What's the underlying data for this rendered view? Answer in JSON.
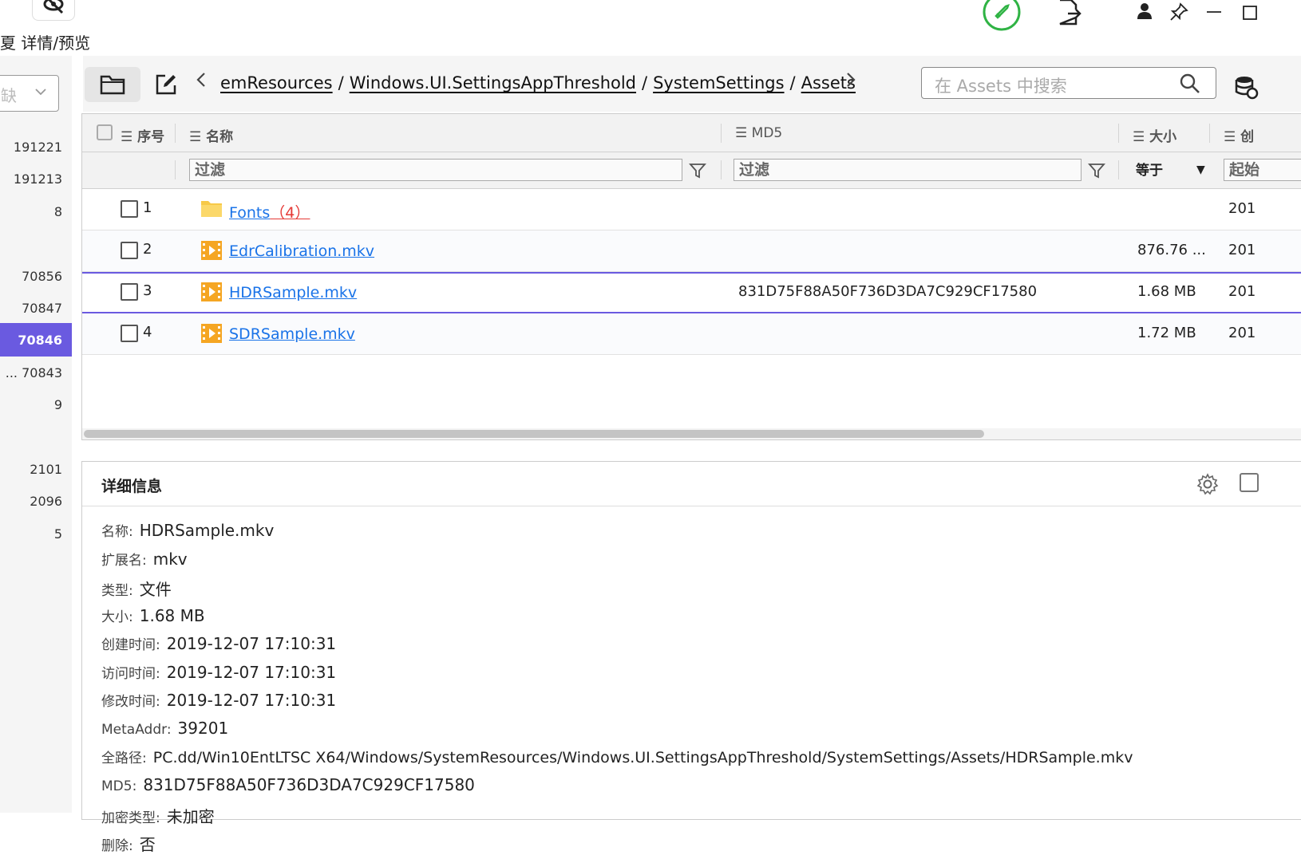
{
  "header": {
    "detail_label": "夏 详情/预览"
  },
  "left_pane": {
    "combo_text": "缺",
    "numbers": [
      "191221",
      "191213",
      "8",
      "70856",
      "70847",
      "70846",
      "... 70843",
      "9",
      "2101",
      "2096",
      "5"
    ],
    "selected_index": 5
  },
  "toolbar": {
    "breadcrumb": [
      "emResources",
      "Windows.UI.SettingsAppThreshold",
      "SystemSettings",
      "Assets"
    ],
    "breadcrumb_sep": "/",
    "search_placeholder": "在 Assets 中搜索"
  },
  "grid": {
    "columns": [
      "序号",
      "名称",
      "MD5",
      "大小",
      "创"
    ],
    "filter_placeholder": "过滤",
    "size_filter": "等于",
    "date_filter": "起始",
    "rows": [
      {
        "num": "1",
        "name": "Fonts",
        "count": "（4）",
        "type": "folder",
        "md5": "",
        "size": "",
        "date": "201"
      },
      {
        "num": "2",
        "name": "EdrCalibration.mkv",
        "count": "",
        "type": "video",
        "md5": "",
        "size": "876.76 ...",
        "date": "201"
      },
      {
        "num": "3",
        "name": "HDRSample.mkv",
        "count": "",
        "type": "video",
        "md5": "831D75F88A50F736D3DA7C929CF17580",
        "size": "1.68 MB",
        "date": "201"
      },
      {
        "num": "4",
        "name": "SDRSample.mkv",
        "count": "",
        "type": "video",
        "md5": "",
        "size": "1.72 MB",
        "date": "201"
      }
    ],
    "selected_row": 2
  },
  "details": {
    "title": "详细信息",
    "props": [
      {
        "k": "名称:",
        "v": "HDRSample.mkv"
      },
      {
        "k": "扩展名:",
        "v": "mkv"
      },
      {
        "k": "类型:",
        "v": "文件"
      },
      {
        "k": "大小:",
        "v": "1.68 MB"
      },
      {
        "k": "创建时间:",
        "v": "2019-12-07 17:10:31"
      },
      {
        "k": "访问时间:",
        "v": "2019-12-07 17:10:31"
      },
      {
        "k": "修改时间:",
        "v": "2019-12-07 17:10:31"
      },
      {
        "k": "MetaAddr:",
        "v": "39201"
      },
      {
        "k": "全路径:",
        "v": "PC.dd/Win10EntLTSC X64/Windows/SystemResources/Windows.UI.SettingsAppThreshold/SystemSettings/Assets/HDRSample.mkv"
      },
      {
        "k": "MD5:",
        "v": "831D75F88A50F736D3DA7C929CF17580"
      },
      {
        "k": "加密类型:",
        "v": "未加密"
      },
      {
        "k": "删除:",
        "v": "否"
      }
    ]
  },
  "colors": {
    "accent": "#6a5ae0",
    "link": "#1a73e8",
    "count_red": "#e53935",
    "status_green": "#2fb344",
    "folder_yellow": "#f7c948",
    "video_orange": "#f5a623"
  }
}
